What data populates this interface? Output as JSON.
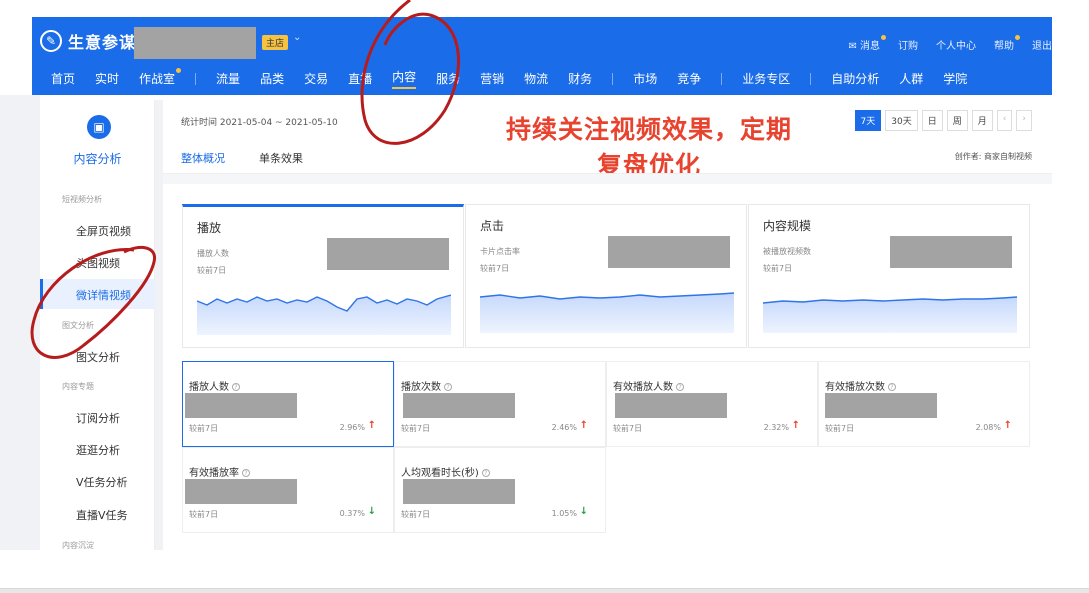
{
  "topbar": {
    "logo_text": "生意参谋",
    "shop_badge": "主店",
    "right_links": [
      "消息",
      "订购",
      "个人中心",
      "帮助",
      "退出"
    ],
    "nav": [
      "首页",
      "实时",
      "作战室",
      "流量",
      "品类",
      "交易",
      "直播",
      "内容",
      "服务",
      "营销",
      "物流",
      "财务",
      "市场",
      "竞争",
      "业务专区",
      "自助分析",
      "人群",
      "学院"
    ],
    "active_nav": "内容",
    "accent": "#1b6ce8"
  },
  "sidebar": {
    "title": "内容分析",
    "groups": [
      {
        "label": "短视频分析",
        "items": [
          "全屏页视频",
          "头图视频",
          "微详情视频"
        ]
      },
      {
        "label": "图文分析",
        "items": [
          "图文分析"
        ]
      },
      {
        "label": "内容专题",
        "items": [
          "订阅分析",
          "逛逛分析",
          "V任务分析",
          "直播V任务"
        ]
      },
      {
        "label": "内容沉淀",
        "items": []
      }
    ],
    "active_item": "微详情视频"
  },
  "content": {
    "date_range": "统计时间 2021-05-04 ~ 2021-05-10",
    "periods": [
      "7天",
      "30天",
      "日",
      "周",
      "月"
    ],
    "active_period": "7天",
    "headline_line1": "持续关注视频效果，定期",
    "headline_line2": "复盘优化",
    "tabs": [
      "整体概况",
      "单条效果"
    ],
    "active_tab": "整体概况",
    "creator": "创作者: 商家自制视频",
    "trend_cards": [
      {
        "title": "播放",
        "sub": "播放人数",
        "cmp": "较前7日"
      },
      {
        "title": "点击",
        "sub": "卡片点击率",
        "cmp": "较前7日"
      },
      {
        "title": "内容规模",
        "sub": "被播放视频数",
        "cmp": "较前7日"
      }
    ],
    "metrics": [
      {
        "title": "播放人数",
        "cmp": "较前7日",
        "pct": "2.96%",
        "dir": "up"
      },
      {
        "title": "播放次数",
        "cmp": "较前7日",
        "pct": "2.46%",
        "dir": "up"
      },
      {
        "title": "有效播放人数",
        "cmp": "较前7日",
        "pct": "2.32%",
        "dir": "up"
      },
      {
        "title": "有效播放次数",
        "cmp": "较前7日",
        "pct": "2.08%",
        "dir": "up"
      },
      {
        "title": "有效播放率",
        "cmp": "较前7日",
        "pct": "0.37%",
        "dir": "down"
      },
      {
        "title": "人均观看时长(秒)",
        "cmp": "较前7日",
        "pct": "1.05%",
        "dir": "down"
      }
    ]
  }
}
